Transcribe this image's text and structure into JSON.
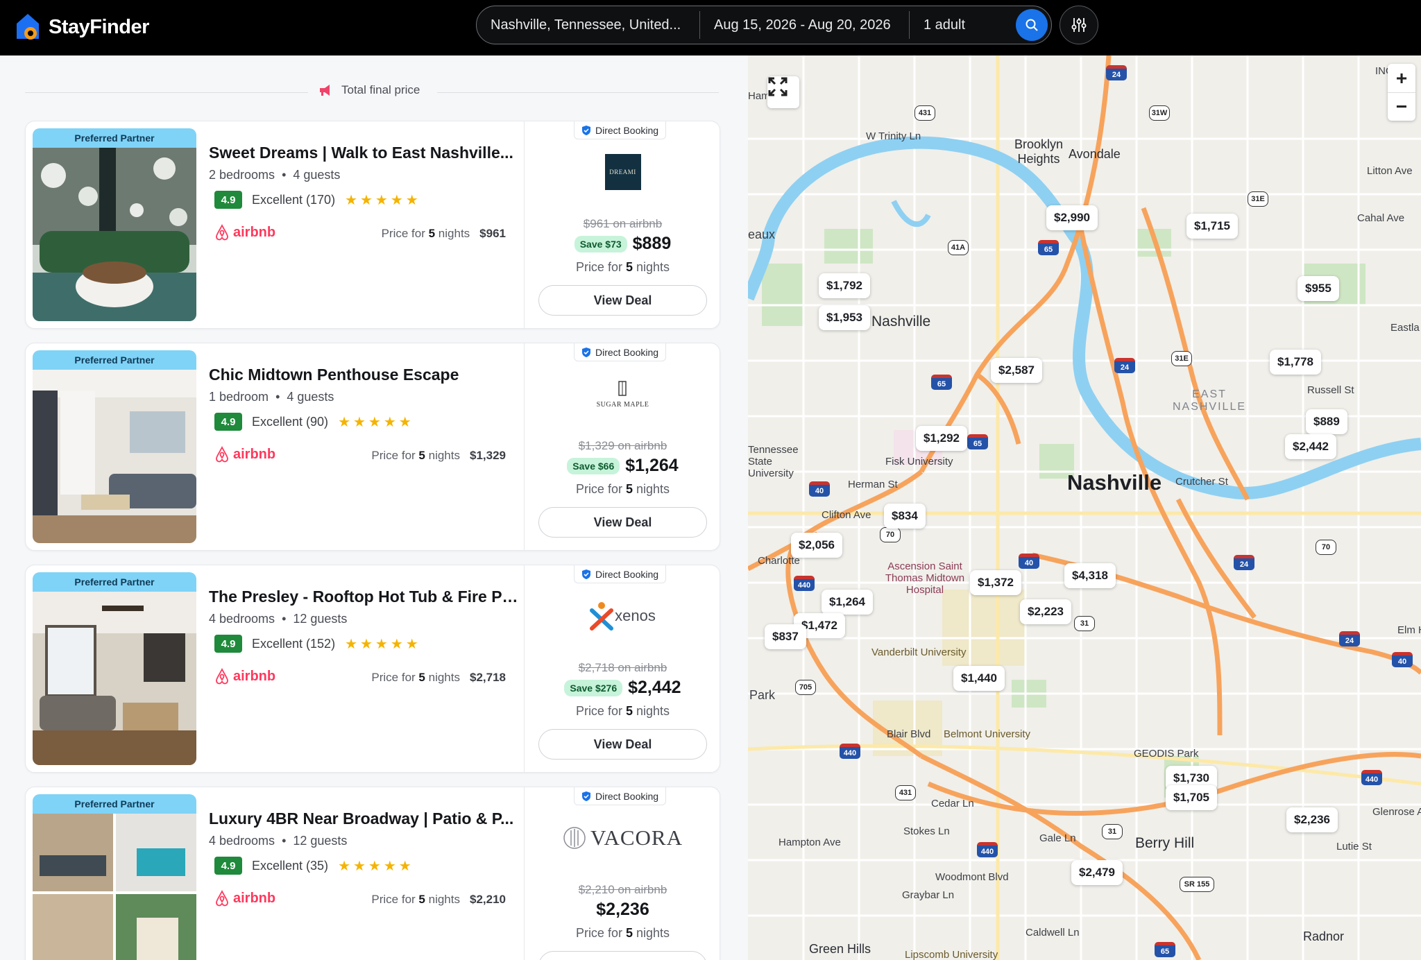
{
  "app": {
    "name": "StayFinder"
  },
  "search": {
    "location": "Nashville, Tennessee, United...",
    "dates": "Aug 15, 2026 - Aug 20, 2026",
    "guests": "1 adult"
  },
  "list": {
    "total_label": "Total final price",
    "listings": [
      {
        "badge": "Preferred Partner",
        "title": "Sweet Dreams | Walk to East Nashville...",
        "bedrooms": "2 bedrooms",
        "guests": "4 guests",
        "score": "4.9",
        "rating_word": "Excellent (170)",
        "stars": "★★★★★",
        "airbnb_label": "airbnb",
        "airbnb_price_prefix": "Price for",
        "airbnb_nights": "5",
        "airbnb_price_suffix": "nights",
        "airbnb_amount": "$961",
        "direct_label": "Direct Booking",
        "partner": "DREAMI",
        "old_price": "$961 on airbnb",
        "save": "Save $73",
        "new_price": "$889",
        "nights_prefix": "Price for",
        "nights": "5",
        "nights_suffix": "nights",
        "cta": "View Deal"
      },
      {
        "badge": "Preferred Partner",
        "title": "Chic Midtown Penthouse Escape",
        "bedrooms": "1 bedroom",
        "guests": "4 guests",
        "score": "4.9",
        "rating_word": "Excellent (90)",
        "stars": "★★★★★",
        "airbnb_label": "airbnb",
        "airbnb_price_prefix": "Price for",
        "airbnb_nights": "5",
        "airbnb_price_suffix": "nights",
        "airbnb_amount": "$1,329",
        "direct_label": "Direct Booking",
        "partner": "SUGAR MAPLE",
        "old_price": "$1,329 on airbnb",
        "save": "Save $66",
        "new_price": "$1,264",
        "nights_prefix": "Price for",
        "nights": "5",
        "nights_suffix": "nights",
        "cta": "View Deal"
      },
      {
        "badge": "Preferred Partner",
        "title": "The Presley - Rooftop Hot Tub & Fire Pi...",
        "bedrooms": "4 bedrooms",
        "guests": "12 guests",
        "score": "4.9",
        "rating_word": "Excellent (152)",
        "stars": "★★★★★",
        "airbnb_label": "airbnb",
        "airbnb_price_prefix": "Price for",
        "airbnb_nights": "5",
        "airbnb_price_suffix": "nights",
        "airbnb_amount": "$2,718",
        "direct_label": "Direct Booking",
        "partner": "xenos",
        "old_price": "$2,718 on airbnb",
        "save": "Save $276",
        "new_price": "$2,442",
        "nights_prefix": "Price for",
        "nights": "5",
        "nights_suffix": "nights",
        "cta": "View Deal"
      },
      {
        "badge": "Preferred Partner",
        "title": "Luxury 4BR Near Broadway | Patio & P...",
        "bedrooms": "4 bedrooms",
        "guests": "12 guests",
        "score": "4.9",
        "rating_word": "Excellent (35)",
        "stars": "★★★★★",
        "airbnb_label": "airbnb",
        "airbnb_price_prefix": "Price for",
        "airbnb_nights": "5",
        "airbnb_price_suffix": "nights",
        "airbnb_amount": "$2,210",
        "direct_label": "Direct Booking",
        "partner": "VACORA",
        "old_price": "$2,210 on airbnb",
        "save": "",
        "new_price": "$2,236",
        "nights_prefix": "Price for",
        "nights": "5",
        "nights_suffix": "nights",
        "cta": "View Deal"
      }
    ]
  },
  "map": {
    "pins": [
      "$2,990",
      "$1,715",
      "$1,792",
      "$1,953",
      "$955",
      "$2,587",
      "$1,778",
      "$889",
      "$2,442",
      "$1,292",
      "$834",
      "$2,056",
      "$4,318",
      "$1,372",
      "$1,264",
      "$2,223",
      "$1,472",
      "$837",
      "$1,440",
      "$1,730",
      "$1,705",
      "$2,236",
      "$2,479"
    ],
    "labels": {
      "city": "Nashville",
      "city_small": "Nashville",
      "brooklyn": "Brooklyn Heights",
      "avondale": "Avondale",
      "east": "EAST NASHVILLE",
      "fisk": "Fisk University",
      "tsu": "Tennessee State University",
      "vandy": "Vanderbilt University",
      "belmont": "Belmont University",
      "ascension": "Ascension Saint Thomas Midtown Hospital",
      "geodis": "GEODIS Park",
      "berry": "Berry Hill",
      "green": "Green Hills",
      "lipscomb": "Lipscomb University",
      "radnor": "Radnor",
      "trinity": "W Trinity Ln",
      "herman": "Herman St",
      "clifton": "Clifton Ave",
      "charlotte": "Charlotte",
      "blair": "Blair Blvd",
      "cedar": "Cedar Ln",
      "gale": "Gale Ln",
      "woodmont": "Woodmont Blvd",
      "hampton": "Hampton Ave",
      "grayber": "Graybar Ln",
      "caldwell": "Caldwell Ln",
      "litton": "Litton Ave",
      "cahal": "Cahal Ave",
      "eastl": "Eastla",
      "russell": "Russell St",
      "crutcher": "Crutcher St",
      "elm": "Elm H",
      "park": "Park",
      "eaux": "eaux",
      "ham": "Ham",
      "ingl": "INGL",
      "stokes": "Stokes Ln",
      "glenrose": "Glenrose Av",
      "lutie": "Lutie St"
    },
    "zoom_in": "+",
    "zoom_out": "−"
  }
}
